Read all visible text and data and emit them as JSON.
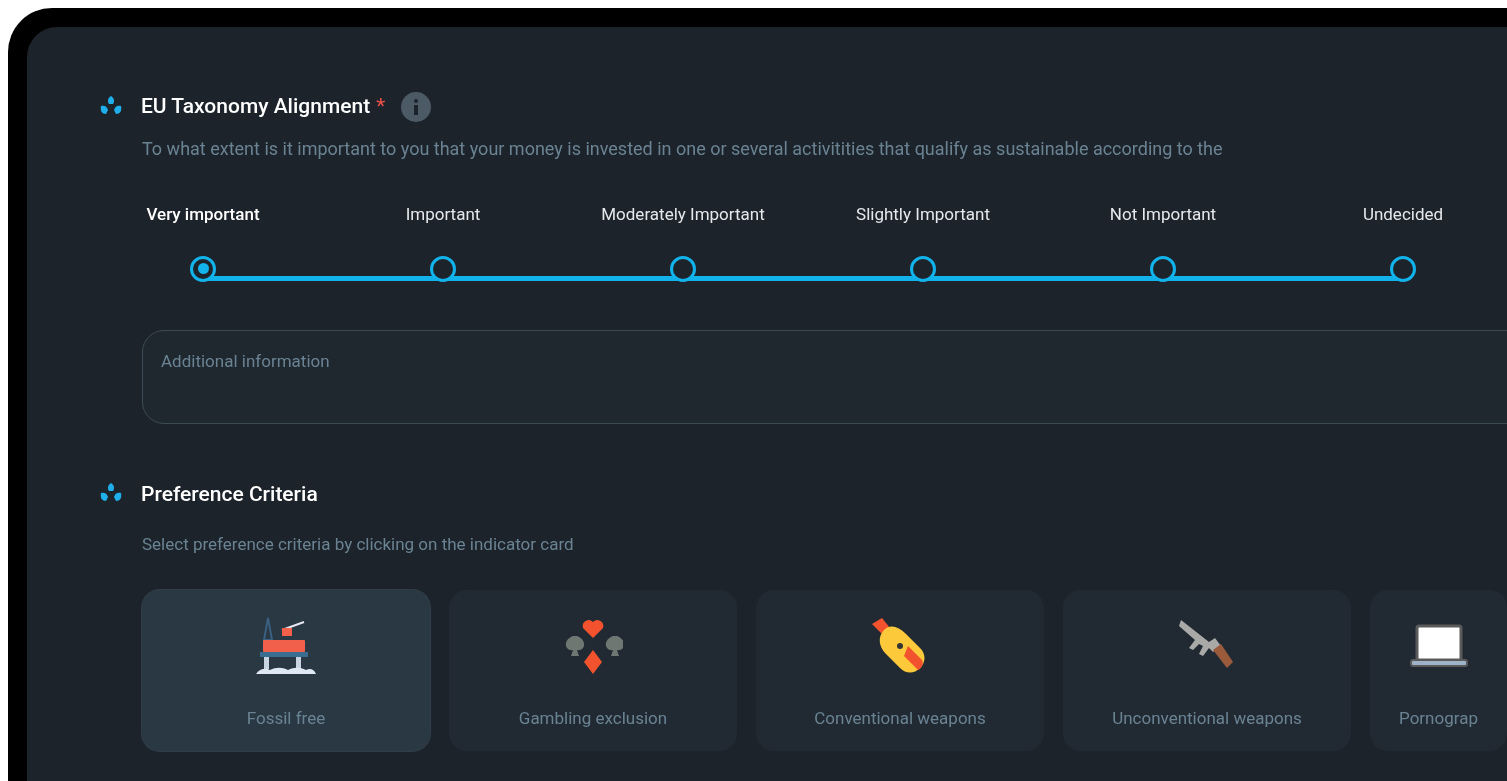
{
  "taxonomy": {
    "title": "EU Taxonomy Alignment",
    "required_mark": "*",
    "description": "To what extent is it important to you that your money is invested in one or several activitities that qualify as sustainable according to the",
    "options": [
      {
        "label": "Very important",
        "selected": true
      },
      {
        "label": "Important",
        "selected": false
      },
      {
        "label": "Moderately Important",
        "selected": false
      },
      {
        "label": "Slightly Important",
        "selected": false
      },
      {
        "label": "Not Important",
        "selected": false
      },
      {
        "label": "Undecided",
        "selected": false
      }
    ],
    "additional_info": {
      "placeholder": "Additional information"
    }
  },
  "preferences": {
    "title": "Preference Criteria",
    "description": "Select preference criteria by clicking on the indicator card",
    "cards": [
      {
        "label": "Fossil free",
        "kind": "rig",
        "selected": true
      },
      {
        "label": "Gambling exclusion",
        "kind": "cards",
        "selected": false
      },
      {
        "label": "Conventional weapons",
        "kind": "bomb",
        "selected": false
      },
      {
        "label": "Unconventional weapons",
        "kind": "rifle",
        "selected": false
      },
      {
        "label": "Pornograp",
        "kind": "laptop",
        "selected": false
      }
    ]
  }
}
